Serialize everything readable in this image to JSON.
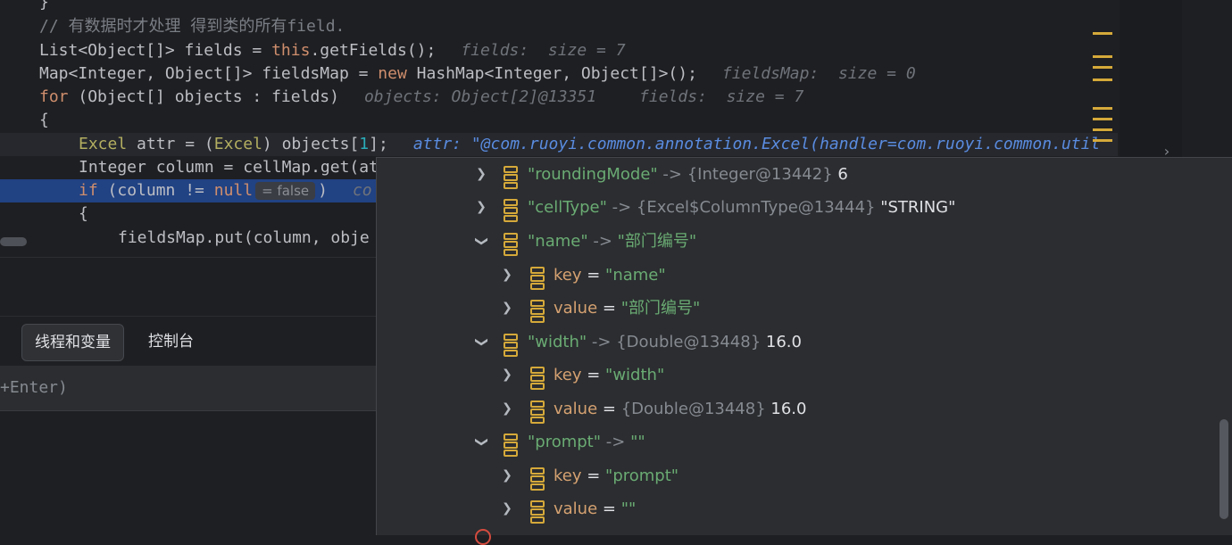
{
  "editor": {
    "lines": {
      "l0": "}",
      "l1_comment": "// 有数据时才处理 得到类的所有field.",
      "l2_a": "List<Object[]> fields = ",
      "l2_kw": "this",
      "l2_b": ".getFields();",
      "l2_hint": "fields:  size = 7",
      "l3_a": "Map<Integer, Object[]> fieldsMap = ",
      "l3_kw": "new",
      "l3_b": " HashMap<Integer, Object[]>();",
      "l3_hint": "fieldsMap:  size = 0",
      "l4_kw": "for",
      "l4_b": " (Object[] objects : fields)",
      "l4_hint1": "objects: Object[2]@13351",
      "l4_hint2": "fields:  size = 7",
      "l5": "{",
      "l6_ann": "Excel",
      "l6_a": " attr = (",
      "l6_ann2": "Excel",
      "l6_b": ") objects[",
      "l6_num": "1",
      "l6_c": "];",
      "l6_hint": "attr: \"@com.ruoyi.common.annotation.Excel(handler=com.ruoyi.common.util",
      "l7": "Integer column = cellMap.get(at",
      "l8_kw": "if",
      "l8_a": " (column != ",
      "l8_kw2": "null",
      "l8_inlay": "= false",
      "l8_b": ")",
      "l8_hint": "co",
      "l9": "{",
      "l10": "fieldsMap.put(column, obje"
    }
  },
  "tabs": {
    "threads_vars": "线程和变量",
    "console": "控制台"
  },
  "eval_hint": "+Enter)",
  "popup": {
    "rows": [
      {
        "name": "\"roundingMode\"",
        "arrow": " -> ",
        "type": "{Integer@13442}",
        "value": " 6"
      },
      {
        "name": "\"cellType\"",
        "arrow": " -> ",
        "type": "{Excel$ColumnType@13444}",
        "value": " \"STRING\""
      },
      {
        "name": "\"name\"",
        "arrow": " -> ",
        "strval": "\"部门编号\""
      },
      {
        "key": "key",
        "eq": " = ",
        "strval": "\"name\""
      },
      {
        "key": "value",
        "eq": " = ",
        "strval": "\"部门编号\""
      },
      {
        "name": "\"width\"",
        "arrow": " -> ",
        "type": "{Double@13448}",
        "value": " 16.0"
      },
      {
        "key": "key",
        "eq": " = ",
        "strval": "\"width\""
      },
      {
        "key": "value",
        "eq": " = ",
        "type": "{Double@13448}",
        "value": " 16.0"
      },
      {
        "name": "\"prompt\"",
        "arrow": " -> ",
        "strval": "\"\""
      },
      {
        "key": "key",
        "eq": " = ",
        "strval": "\"prompt\""
      },
      {
        "key": "value",
        "eq": " = ",
        "strval": "\"\""
      }
    ]
  },
  "colors": {
    "string": "#6aab73",
    "keyword": "#cf8e6d",
    "field_icon": "#d5a93a",
    "selection": "#214283"
  }
}
